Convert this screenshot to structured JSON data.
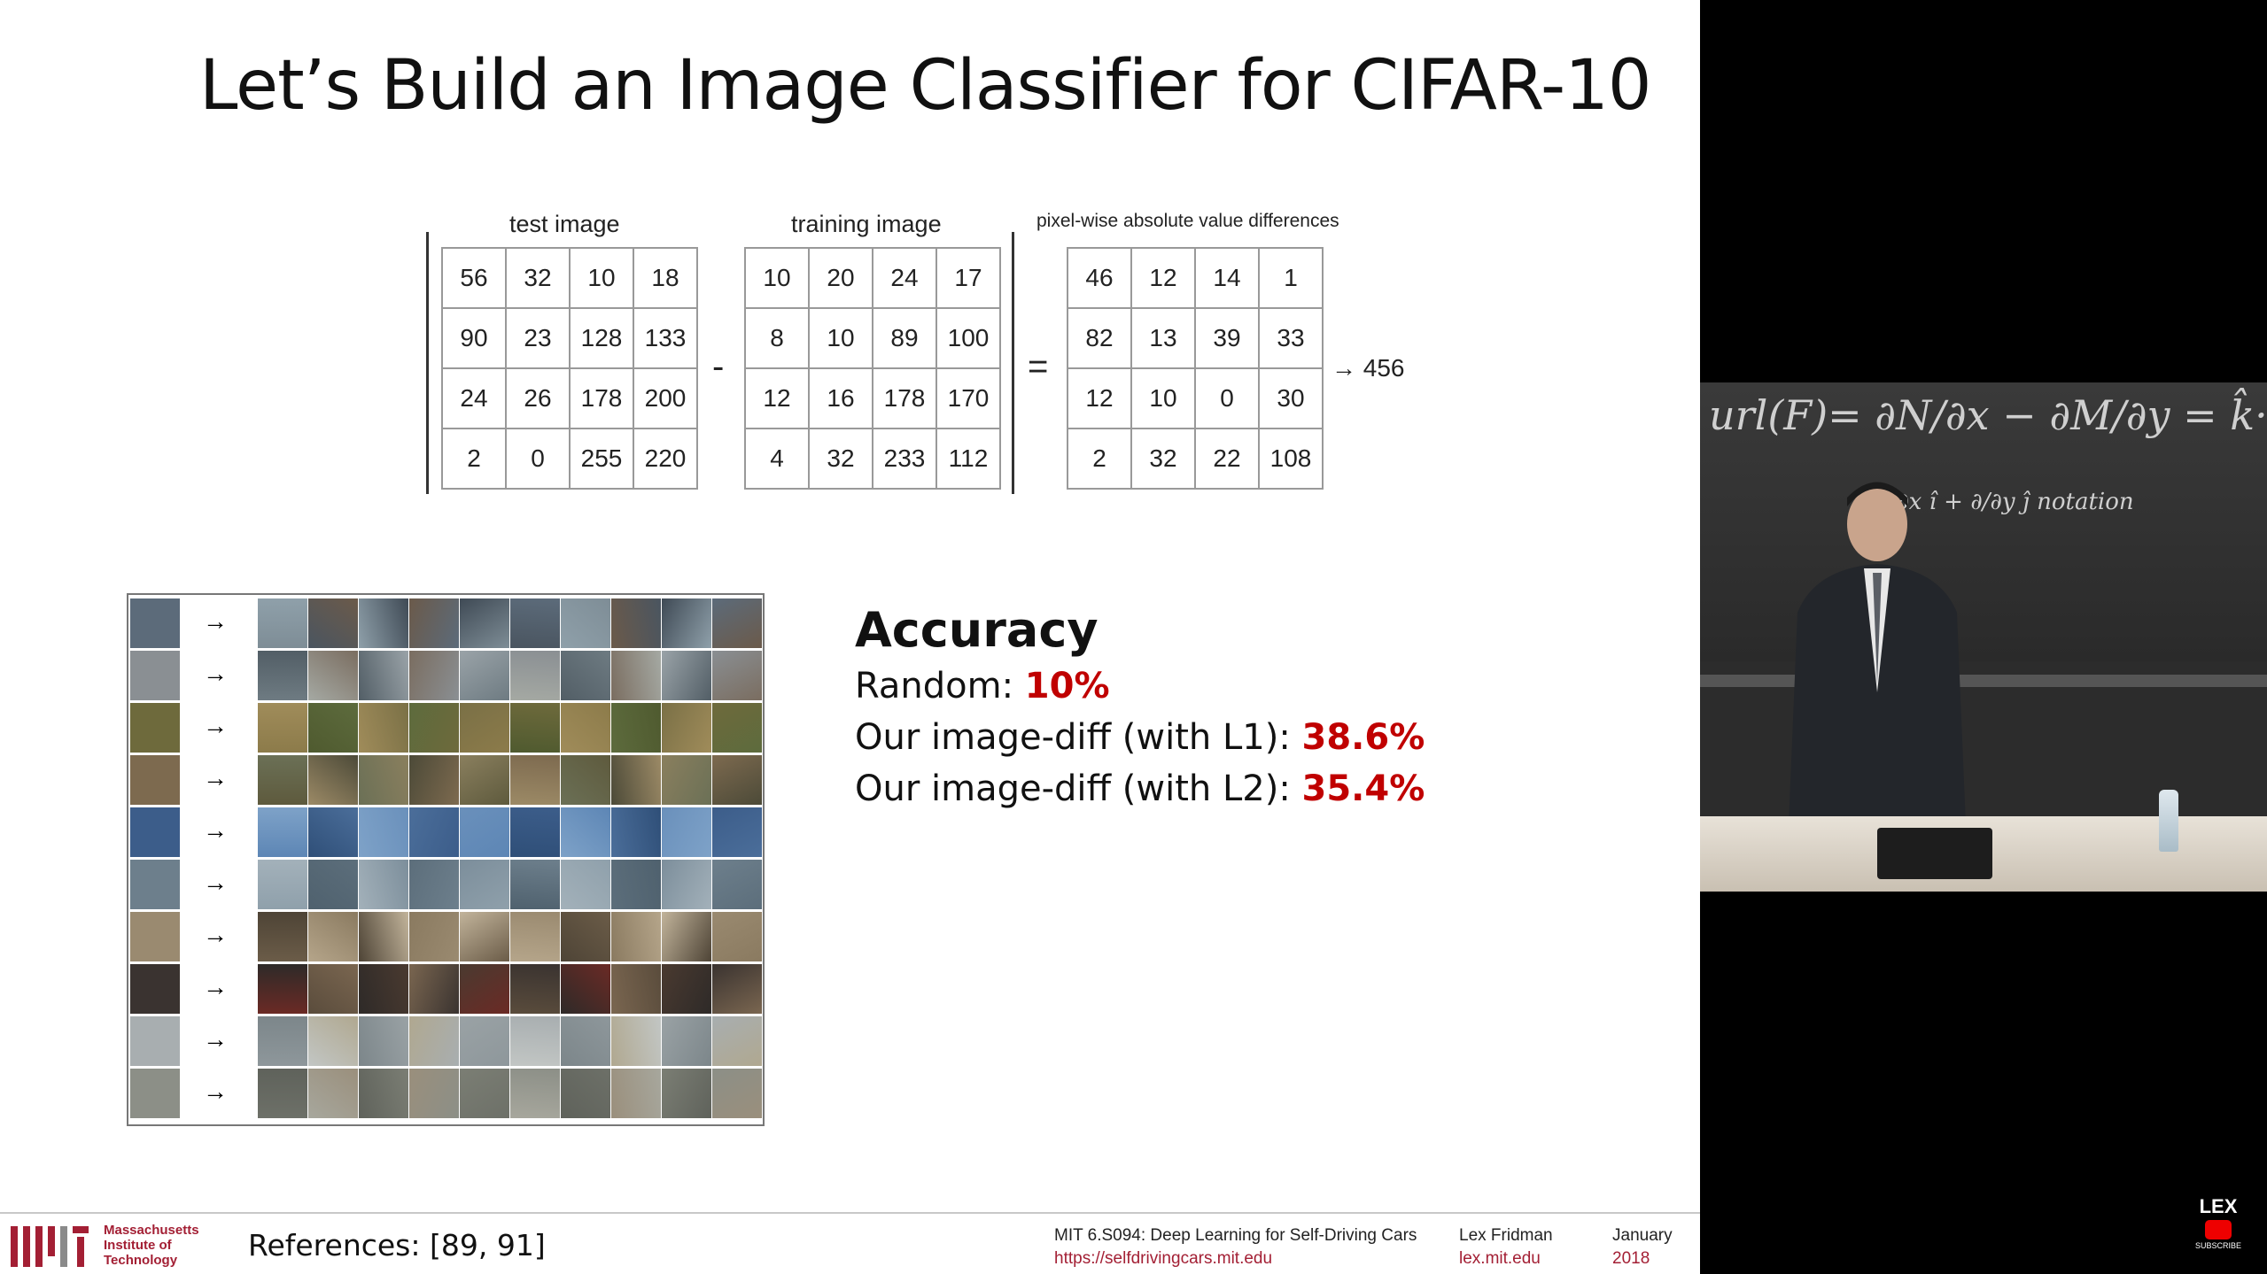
{
  "slide": {
    "title": "Let’s Build an Image Classifier for CIFAR-10",
    "test_caption": "test image",
    "train_caption": "training image",
    "diff_caption": "pixel-wise absolute value differences",
    "minus": "-",
    "equals": "=",
    "result_arrow": "→ 456",
    "test_matrix": [
      [
        "56",
        "32",
        "10",
        "18"
      ],
      [
        "90",
        "23",
        "128",
        "133"
      ],
      [
        "24",
        "26",
        "178",
        "200"
      ],
      [
        "2",
        "0",
        "255",
        "220"
      ]
    ],
    "train_matrix": [
      [
        "10",
        "20",
        "24",
        "17"
      ],
      [
        "8",
        "10",
        "89",
        "100"
      ],
      [
        "12",
        "16",
        "178",
        "170"
      ],
      [
        "4",
        "32",
        "233",
        "112"
      ]
    ],
    "diff_matrix": [
      [
        "46",
        "12",
        "14",
        "1"
      ],
      [
        "82",
        "13",
        "39",
        "33"
      ],
      [
        "12",
        "10",
        "0",
        "30"
      ],
      [
        "2",
        "32",
        "22",
        "108"
      ]
    ],
    "grid_arrow": "→",
    "accuracy": {
      "title": "Accuracy",
      "random_label": "Random: ",
      "random_value": "10%",
      "l1_label": "Our image-diff (with L1): ",
      "l1_value": "38.6%",
      "l2_label": "Our image-diff (with L2): ",
      "l2_value": "35.4%"
    }
  },
  "footer": {
    "mit_name_1": "Massachusetts",
    "mit_name_2": "Institute of",
    "mit_name_3": "Technology",
    "references": "References: [89, 91]",
    "course": "MIT 6.S094: Deep Learning for Self-Driving Cars",
    "course_url": "https://selfdrivingcars.mit.edu",
    "author": "Lex Fridman",
    "author_url": "lex.mit.edu",
    "month": "January",
    "year": "2018"
  },
  "video": {
    "channel": "LEX",
    "subscribe": "SUBSCRIBE"
  },
  "colors": {
    "accent_red": "#c00000",
    "mit_red": "#a31f34"
  }
}
